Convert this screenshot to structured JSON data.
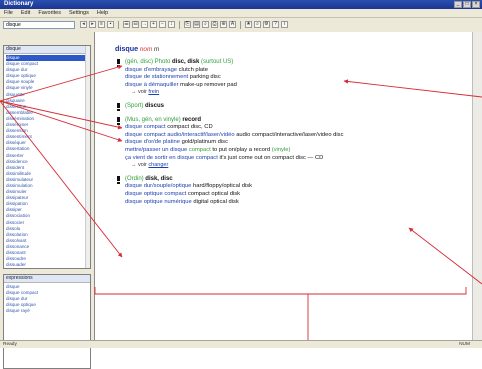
{
  "window": {
    "title": "Dictionary"
  },
  "menu": [
    "File",
    "Edit",
    "Favorites",
    "Settings",
    "Help"
  ],
  "search": {
    "value": "disque"
  },
  "toolbar_icons": [
    "back",
    "forward",
    "copy",
    "print",
    "zoom",
    "font",
    "favorites",
    "search",
    "settings",
    "help"
  ],
  "sidebar": {
    "top_header": "disque",
    "words": [
      "disque",
      "disque compact",
      "disque dur",
      "disque optique",
      "disque souple",
      "disque vinyle",
      "disquette",
      "disquaire",
      "dissection",
      "dissemblable",
      "dissémination",
      "disséminer",
      "dissension",
      "dissentiment",
      "disséquer",
      "dissertation",
      "disserter",
      "dissidence",
      "dissident",
      "dissimilitude",
      "dissimulateur",
      "dissimulation",
      "dissimuler",
      "dissipateur",
      "dissipation",
      "dissiper",
      "dissociation",
      "dissocier",
      "dissolu",
      "dissolution",
      "dissolvant",
      "dissonance",
      "dissonant",
      "dissoudre",
      "dissuader",
      "dissuasion"
    ],
    "bottom_header": "expressions",
    "bottom_words": [
      "disque",
      "disque compact",
      "disque dur",
      "disque optique",
      "disque rayé"
    ]
  },
  "entry": {
    "headword": "disque",
    "pos": "nom",
    "gender": "m",
    "senses": [
      {
        "domain": "(gén, disc) Photo",
        "translation": "disc, disk",
        "domain2": "(surtout US)",
        "lines": [
          {
            "fr": "disque d'embrayage",
            "en": "clutch plate"
          },
          {
            "fr": "disque de stationnement",
            "en": "parking disc"
          },
          {
            "fr": "disque à démaquiller",
            "en": "make-up remover pad"
          }
        ],
        "voir_label": "→ voir",
        "voir_link": "frein"
      },
      {
        "domain": "(Sport)",
        "translation": "discus",
        "lines": [],
        "voir_label": "",
        "voir_link": ""
      },
      {
        "domain": "(Mus, gén, en vinyle)",
        "translation": "record",
        "lines": [
          {
            "fr": "disque compact",
            "en": "compact disc, CD"
          },
          {
            "fr": "disque compact audio/interactif/laser/vidéo",
            "en": "audio compact/interactive/laser/video disc"
          },
          {
            "fr": "disque d'or/de platine",
            "en": "gold/platinum disc"
          },
          {
            "fr": "mettre/passer un disque",
            "en": "to put on/play a record",
            "note": "compact",
            "note2": "(vinyle)"
          },
          {
            "fr": "ça vient de sortir en disque compact",
            "en": "it's just come out on compact disc — CD"
          }
        ],
        "voir_label": "→ voir",
        "voir_link": "changer"
      },
      {
        "domain": "(Ordin)",
        "translation": "disk, disc",
        "lines": [
          {
            "fr": "disque dur/souple/optique",
            "en": "hard/floppy/optical disk"
          },
          {
            "fr": "disque optique compact",
            "en": "compact optical disk"
          },
          {
            "fr": "disque optique numérique",
            "en": "digital optical disk"
          }
        ],
        "voir_label": "",
        "voir_link": ""
      }
    ]
  },
  "status": {
    "left": "Ready",
    "right": "NUM"
  },
  "colors": {
    "arrow": "#d62b35",
    "link": "#1a3fb0",
    "domain": "#2f9f3a",
    "pos": "#d43030"
  }
}
